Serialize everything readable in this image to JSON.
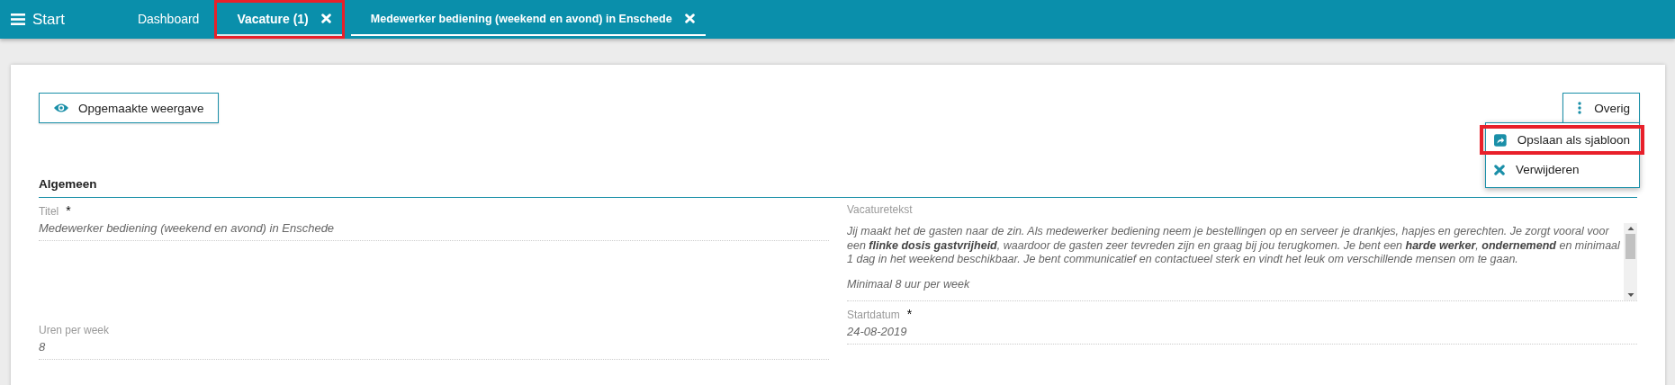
{
  "topbar": {
    "menu_label": "Start",
    "tabs": [
      {
        "label": "Dashboard",
        "selected": false,
        "closable": false,
        "highlighted": false
      },
      {
        "label": "Vacature (1)",
        "selected": false,
        "closable": true,
        "highlighted": true
      },
      {
        "label": "Medewerker bediening (weekend en avond) in Enschede",
        "selected": true,
        "closable": true,
        "highlighted": false
      }
    ]
  },
  "toolbar": {
    "view_button": "Opgemaakte weergave",
    "more_button": "Overig",
    "menu_open": true,
    "menu": [
      {
        "label": "Opslaan als sjabloon",
        "kind": "template",
        "highlighted": true
      },
      {
        "label": "Verwijderen",
        "kind": "delete",
        "highlighted": false
      }
    ]
  },
  "section": {
    "title": "Algemeen"
  },
  "fields": {
    "left": [
      {
        "label": "Titel",
        "required_mark": "*",
        "value": "Medewerker bediening (weekend en avond) in Enschede"
      },
      {
        "label": "Uren per week",
        "value": "8"
      }
    ],
    "vacancy_text": {
      "label": "Vacaturetekst",
      "paragraphs": [
        "Jij maakt het de gasten naar de zin. Als medewerker bediening neem je bestellingen op en serveer je drankjes, hapjes en gerechten. Je zorgt vooral voor een **flinke dosis gastvrijheid**, waardoor de gasten zeer tevreden zijn en graag bij jou terugkomen. Je bent een **harde werker**, **ondernemend** en minimaal 1 dag in het weekend beschikbaar. Je bent communicatief en contactueel sterk en vindt het leuk om verschillende mensen om te gaan.",
        "Minimaal 8 uur per week"
      ]
    },
    "start_date": {
      "label": "Startdatum",
      "required_mark": "*",
      "value": "24-08-2019"
    }
  }
}
